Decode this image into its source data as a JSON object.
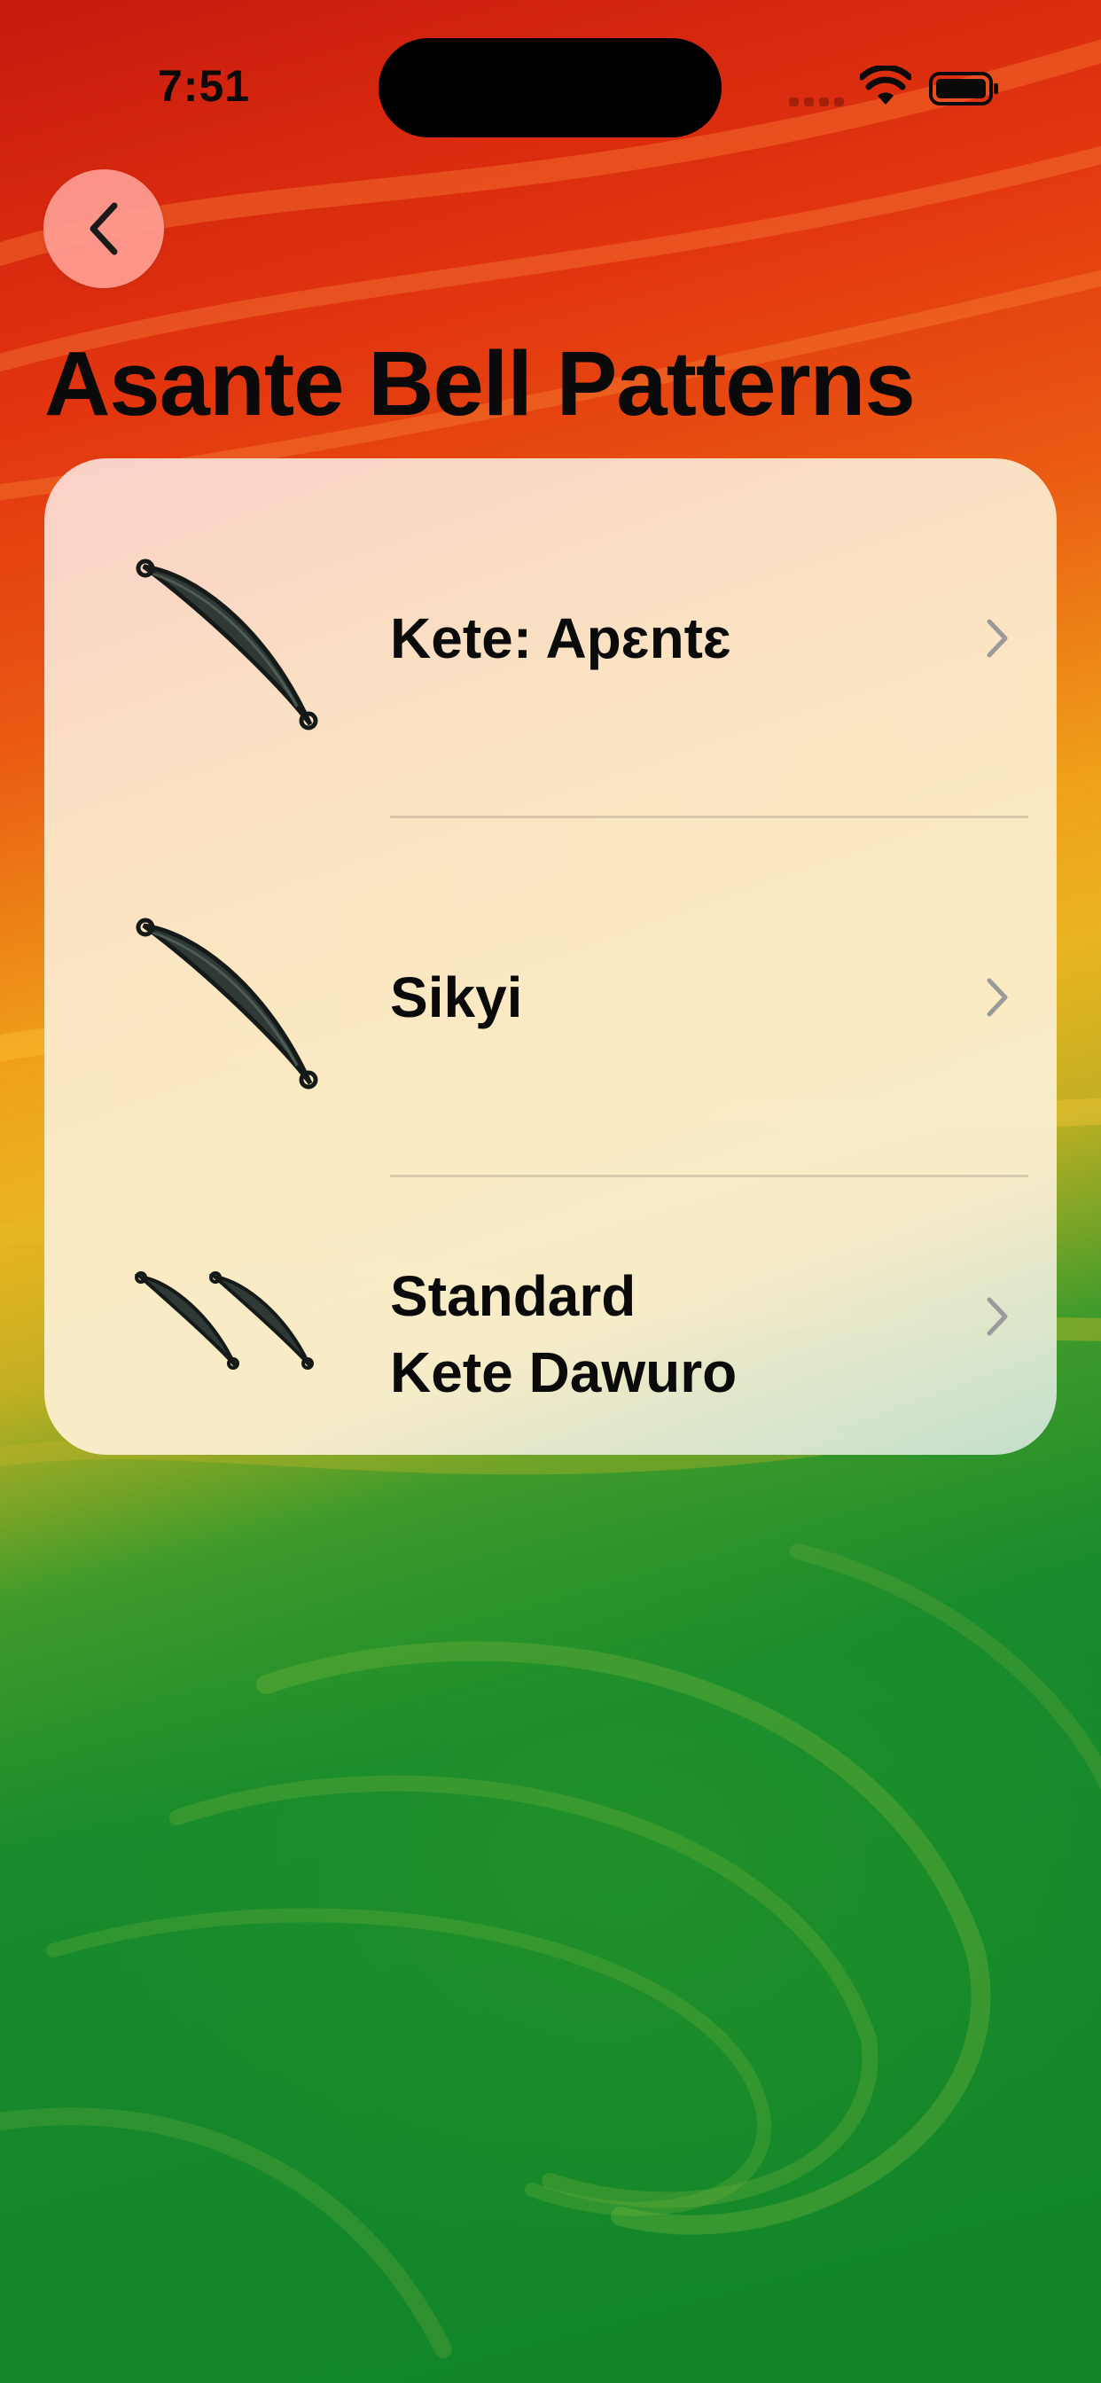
{
  "status_bar": {
    "time": "7:51"
  },
  "header": {
    "title": "Asante Bell Patterns"
  },
  "patterns": [
    {
      "label_lines": [
        "Kete: Apɛntɛ"
      ],
      "icon": "single-bell-icon"
    },
    {
      "label_lines": [
        "Sikyi"
      ],
      "icon": "single-bell-icon"
    },
    {
      "label_lines": [
        "Standard",
        "Kete Dawuro"
      ],
      "icon": "double-bell-icon"
    }
  ],
  "colors": {
    "back_button": "#ffa096",
    "card": "#fbecc8",
    "text": "#0a0a0a",
    "chevron": "#9a9a9a"
  }
}
